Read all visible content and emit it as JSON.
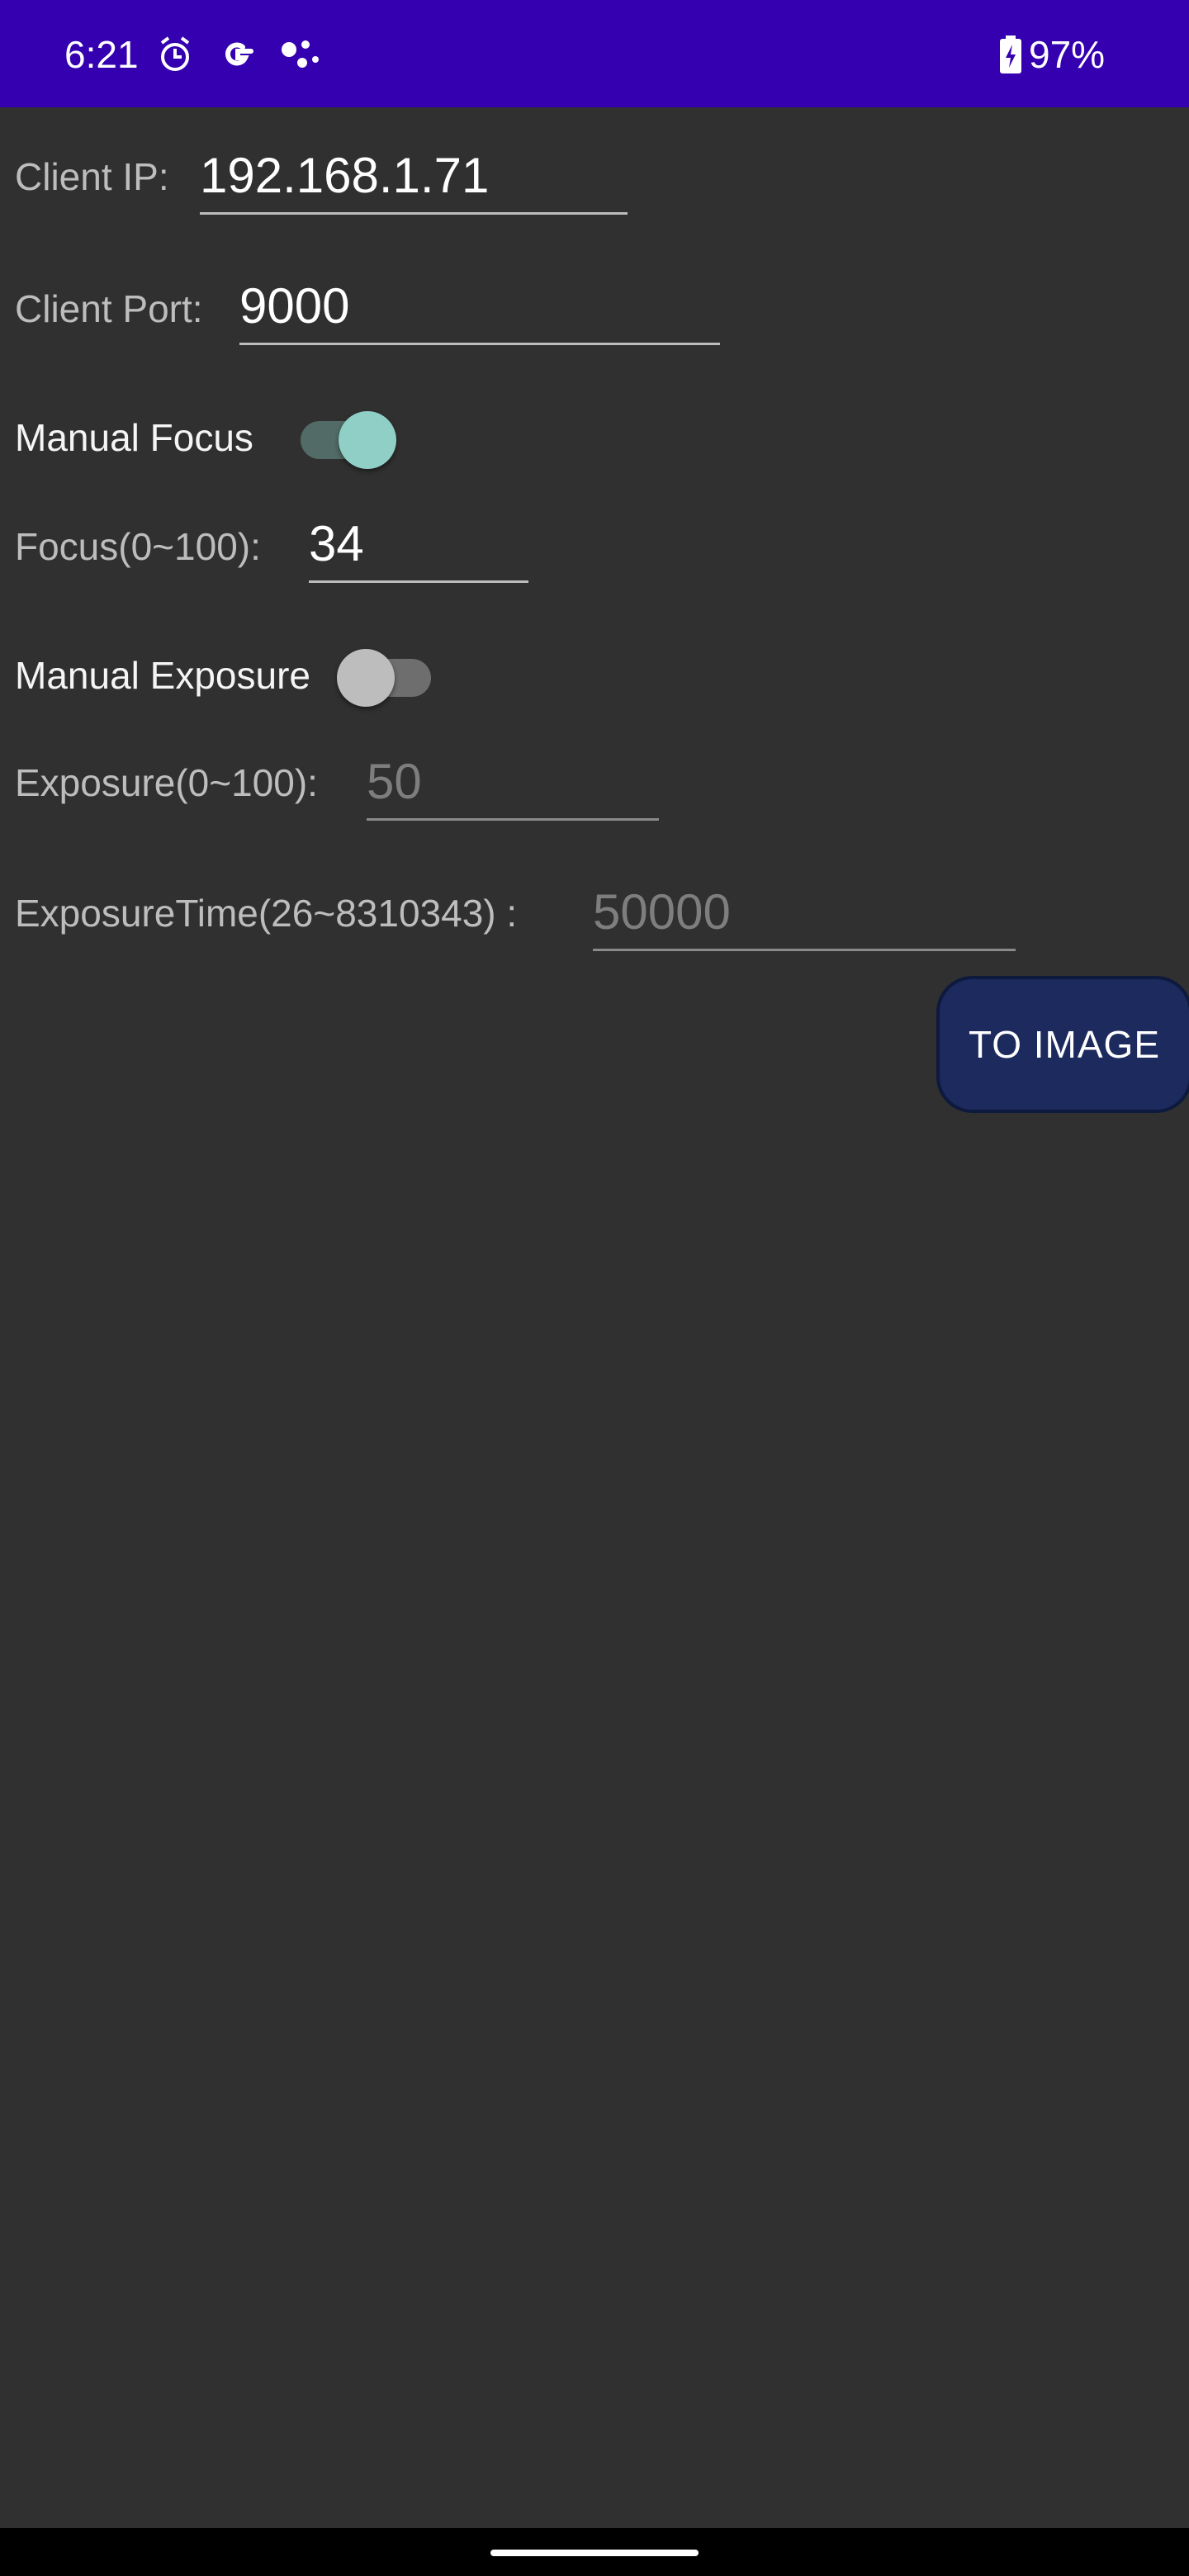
{
  "status_bar": {
    "time": "6:21",
    "icons": [
      "alarm-clock-icon",
      "google-g-icon",
      "assistant-dots-icon"
    ],
    "battery_icon": "battery-charging-icon",
    "battery_percent": "97%",
    "background": "#3400B0"
  },
  "form": {
    "client_ip": {
      "label": "Client IP:",
      "value": "192.168.1.71"
    },
    "client_port": {
      "label": "Client Port:",
      "value": "9000"
    },
    "manual_focus": {
      "label": "Manual Focus",
      "checked": true
    },
    "focus": {
      "label": "Focus(0~100):",
      "value": "34"
    },
    "manual_exposure": {
      "label": "Manual Exposure",
      "checked": false
    },
    "exposure": {
      "label": "Exposure(0~100):",
      "value": "50"
    },
    "exposure_time": {
      "label": "ExposureTime(26~8310343) :",
      "value": "50000"
    }
  },
  "actions": {
    "to_image_label": "TO IMAGE"
  },
  "colors": {
    "background": "#303030",
    "accent_switch_on": "#8FCFC6",
    "button": "#1C2A5E"
  }
}
